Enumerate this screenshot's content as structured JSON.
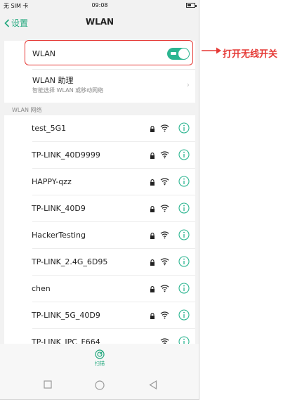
{
  "status_bar": {
    "carrier": "无 SIM 卡",
    "time": "09:08"
  },
  "nav": {
    "back_label": "设置",
    "title": "WLAN"
  },
  "wlan_toggle": {
    "label": "WLAN",
    "enabled": true
  },
  "assistant": {
    "title": "WLAN 助理",
    "subtitle": "智能选择 WLAN 或移动网络"
  },
  "section_label": "WLAN 网络",
  "networks": [
    {
      "name": "test_5G1",
      "locked": true
    },
    {
      "name": "TP-LINK_40D9999",
      "locked": true
    },
    {
      "name": "HAPPY-qzz",
      "locked": true
    },
    {
      "name": "TP-LINK_40D9",
      "locked": true
    },
    {
      "name": "HackerTesting",
      "locked": true
    },
    {
      "name": "TP-LINK_2.4G_6D95",
      "locked": true
    },
    {
      "name": "chen",
      "locked": true
    },
    {
      "name": "TP-LINK_5G_40D9",
      "locked": true
    },
    {
      "name": "TP-LINK_IPC_F664",
      "locked": false
    }
  ],
  "bottom": {
    "scan_label": "扫描"
  },
  "annotation": {
    "text": "打开无线开关"
  },
  "colors": {
    "accent": "#1fa77c",
    "toggle_on": "#2bb590",
    "annotation": "#e53935"
  }
}
